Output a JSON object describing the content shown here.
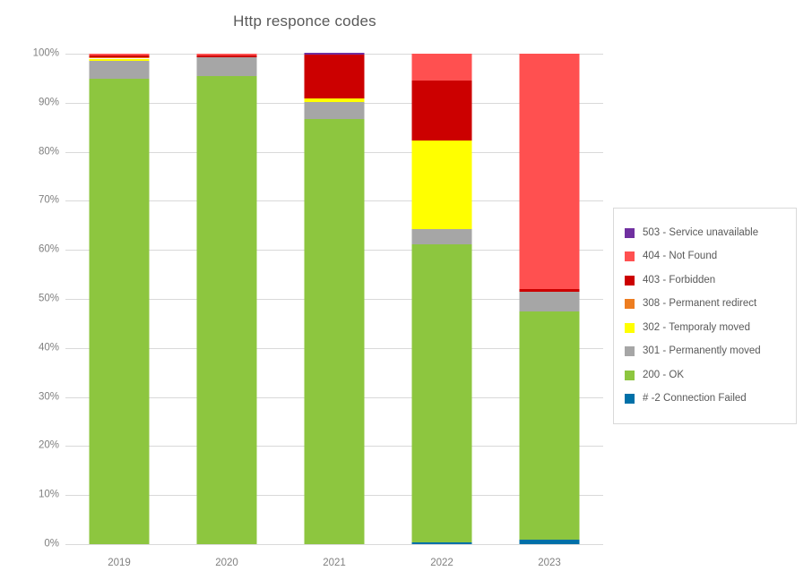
{
  "chart_data": {
    "type": "bar",
    "stacked": true,
    "normalized_percent": true,
    "title": "Http responce codes",
    "xlabel": "",
    "ylabel": "",
    "categories": [
      "2019",
      "2020",
      "2021",
      "2022",
      "2023"
    ],
    "ylim": [
      0,
      100
    ],
    "ytick_labels": [
      "0%",
      "10%",
      "20%",
      "30%",
      "40%",
      "50%",
      "60%",
      "70%",
      "80%",
      "90%",
      "100%"
    ],
    "ytick_values": [
      0,
      10,
      20,
      30,
      40,
      50,
      60,
      70,
      80,
      90,
      100
    ],
    "grid": true,
    "legend_position": "right",
    "series": [
      {
        "name": "# -2 Connection Failed",
        "color": "#0070A8",
        "values": [
          0,
          0,
          0,
          0.4,
          1.0
        ]
      },
      {
        "name": "200 - OK",
        "color": "#8DC63F",
        "values": [
          94.9,
          95.4,
          86.7,
          60.7,
          46.5
        ]
      },
      {
        "name": "301 - Permanently moved",
        "color": "#A6A6A6",
        "values": [
          3.7,
          3.8,
          3.4,
          3.1,
          4.0
        ]
      },
      {
        "name": "302 - Temporaly moved",
        "color": "#FFFF00",
        "values": [
          0.4,
          0,
          0.7,
          18.1,
          0
        ]
      },
      {
        "name": "308 - Permanent redirect",
        "color": "#ED7D20",
        "values": [
          0.3,
          0,
          0,
          0,
          0
        ]
      },
      {
        "name": "403 - Forbidden",
        "color": "#CC0000",
        "values": [
          0.3,
          0.5,
          9.1,
          12.2,
          0.6
        ]
      },
      {
        "name": "404 - Not Found",
        "color": "#FF5050",
        "values": [
          0.4,
          0.3,
          0,
          5.5,
          47.9
        ]
      },
      {
        "name": "503 - Service unavailable",
        "color": "#7030A0",
        "values": [
          0,
          0,
          0.2,
          0,
          0
        ]
      }
    ]
  },
  "legend": {
    "items": [
      {
        "label": "503 - Service unavailable",
        "color": "#7030A0"
      },
      {
        "label": "404 - Not Found",
        "color": "#FF5050"
      },
      {
        "label": "403 - Forbidden",
        "color": "#CC0000"
      },
      {
        "label": "308 - Permanent redirect",
        "color": "#ED7D20"
      },
      {
        "label": "302 - Temporaly moved",
        "color": "#FFFF00"
      },
      {
        "label": "301 - Permanently moved",
        "color": "#A6A6A6"
      },
      {
        "label": "200 - OK",
        "color": "#8DC63F"
      },
      {
        "label": "# -2 Connection Failed",
        "color": "#0070A8"
      }
    ]
  }
}
